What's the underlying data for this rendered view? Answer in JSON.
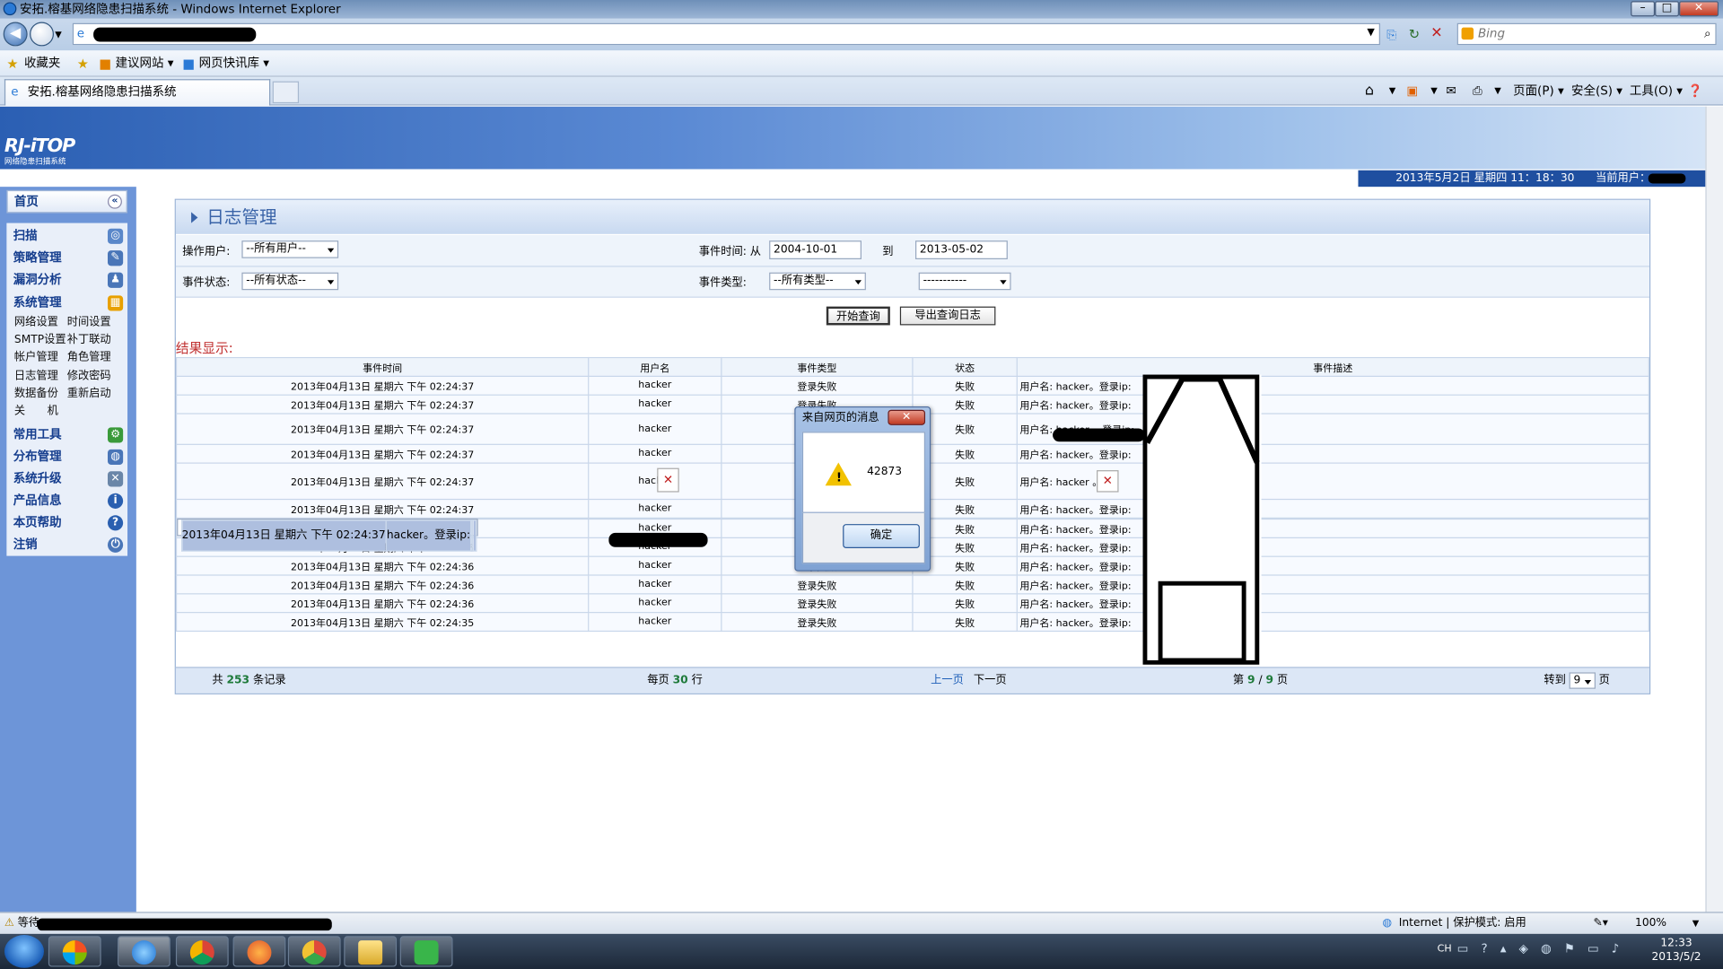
{
  "window": {
    "title": "安拓.榕基网络隐患扫描系统 - Windows Internet Explorer",
    "min": "–",
    "max": "□",
    "close": "✕"
  },
  "browser": {
    "search_placeholder": "Bing",
    "favorites_label": "收藏夹",
    "fav_items": [
      "建议网站 ▾",
      "网页快讯库 ▾"
    ],
    "tab_title": "安拓.榕基网络隐患扫描系统",
    "commands": [
      "页面(P) ▾",
      "安全(S) ▾",
      "工具(O) ▾"
    ]
  },
  "banner": {
    "logo": "RJ-iTOP",
    "logo_sub": "网络隐患扫描系统",
    "date_text": "2013年5月2日 星期四 11：18：30",
    "current_user_label": "当前用户："
  },
  "sidebar": {
    "home": "首页",
    "collapse": "«",
    "items": [
      {
        "label": "扫描",
        "icon": "scan-icon"
      },
      {
        "label": "策略管理",
        "icon": "policy-icon"
      },
      {
        "label": "漏洞分析",
        "icon": "vuln-icon"
      },
      {
        "label": "系统管理",
        "icon": "calendar-icon"
      },
      {
        "label": "常用工具",
        "icon": "tools-icon"
      },
      {
        "label": "分布管理",
        "icon": "globe-icon"
      },
      {
        "label": "系统升级",
        "icon": "upgrade-icon"
      },
      {
        "label": "产品信息",
        "icon": "info-icon"
      },
      {
        "label": "本页帮助",
        "icon": "help-icon"
      },
      {
        "label": "注销",
        "icon": "logout-icon"
      }
    ],
    "sub_items": [
      "网络设置",
      "时间设置",
      "SMTP设置",
      "补丁联动",
      "帐户管理",
      "角色管理",
      "日志管理",
      "修改密码",
      "数据备份",
      "重新启动",
      "关　　机"
    ]
  },
  "panel": {
    "title": "日志管理",
    "filters": {
      "user_label": "操作用户:",
      "user_value": "--所有用户--",
      "time_label": "事件时间: 从",
      "time_from": "2004-10-01",
      "time_to_label": "到",
      "time_to": "2013-05-02",
      "status_label": "事件状态:",
      "status_value": "--所有状态--",
      "type_label": "事件类型:",
      "type_value": "--所有类型--",
      "type_sub_value": "-----------"
    },
    "buttons": {
      "query": "开始查询",
      "export": "导出查询日志"
    },
    "results_label": "结果显示:",
    "columns": [
      "事件时间",
      "用户名",
      "事件类型",
      "状态",
      "事件描述"
    ],
    "rows": [
      {
        "time": "2013年04月13日 星期六 下午 02:24:37",
        "user": "hacker",
        "type": "登录失败",
        "status": "失败",
        "desc": "用户名: hacker。登录ip:"
      },
      {
        "time": "2013年04月13日 星期六 下午 02:24:37",
        "user": "hacker",
        "type": "登录失败",
        "status": "失败",
        "desc": "用户名: hacker。登录ip:"
      },
      {
        "time": "2013年04月13日 星期六 下午 02:24:37",
        "user": "hacker",
        "type": "",
        "status": "失败",
        "desc": "用户名: hacker 。登录ip:"
      },
      {
        "time": "2013年04月13日 星期六 下午 02:24:37",
        "user": "hacker",
        "type": "",
        "status": "失败",
        "desc": "用户名: hacker。登录ip:"
      },
      {
        "time": "2013年04月13日 星期六 下午 02:24:37",
        "user": "hacker",
        "type": "",
        "status": "失败",
        "desc": "用户名: hacker 。登"
      },
      {
        "time": "2013年04月13日 星期六 下午 02:24:37",
        "user": "hacker",
        "type": "",
        "status": "失败",
        "desc": "用户名: hacker。登录ip:"
      },
      {
        "time": "2013年04月13日 星期六 下午 02:24:37",
        "user": "hacker。登录ip:",
        "type": "",
        "status": "",
        "desc": ""
      },
      {
        "time": "2013年04月13日 星期六 下午 02:24:37",
        "user": "hacker",
        "type": "",
        "status": "失败",
        "desc": "用户名: hacker。登录ip:"
      },
      {
        "time": "2013年04月13日 星期六 下午 02:24:36",
        "user": "hacker",
        "type": "登录失败",
        "status": "失败",
        "desc": "用户名: hacker。登录ip:"
      },
      {
        "time": "2013年04月13日 星期六 下午 02:24:36",
        "user": "hacker",
        "type": "登录失败",
        "status": "失败",
        "desc": "用户名: hacker。登录ip:"
      },
      {
        "time": "2013年04月13日 星期六 下午 02:24:36",
        "user": "hacker",
        "type": "登录失败",
        "status": "失败",
        "desc": "用户名: hacker。登录ip:"
      },
      {
        "time": "2013年04月13日 星期六 下午 02:24:36",
        "user": "hacker",
        "type": "登录失败",
        "status": "失败",
        "desc": "用户名: hacker。登录ip:"
      },
      {
        "time": "2013年04月13日 星期六 下午 02:24:35",
        "user": "hacker",
        "type": "登录失败",
        "status": "失败",
        "desc": "用户名: hacker。登录ip:"
      }
    ],
    "footer": {
      "total_prefix": "共",
      "total": "253",
      "total_suffix": "条记录",
      "per_page_prefix": "每页",
      "per_page": "30",
      "per_page_suffix": "行",
      "prev": "上一页",
      "next": "下一页",
      "page_prefix": "第",
      "page": "9",
      "page_sep": "/",
      "pages": "9",
      "page_suffix": "页",
      "goto_label": "转到",
      "goto_value": "9",
      "goto_suffix": "页"
    }
  },
  "dialog": {
    "title": "来自网页的消息",
    "message": "42873",
    "ok": "确定",
    "close": "✕"
  },
  "statusbar": {
    "loading": "等待",
    "zone": "Internet | 保护模式: 启用",
    "zoom": "100%"
  },
  "taskbar": {
    "time": "12:33",
    "date": "2013/5/2",
    "lang": "CH"
  }
}
